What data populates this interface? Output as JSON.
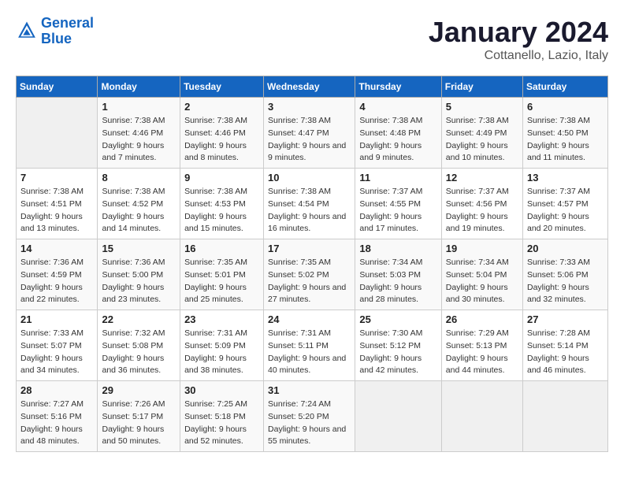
{
  "logo": {
    "line1": "General",
    "line2": "Blue"
  },
  "title": "January 2024",
  "subtitle": "Cottanello, Lazio, Italy",
  "days_of_week": [
    "Sunday",
    "Monday",
    "Tuesday",
    "Wednesday",
    "Thursday",
    "Friday",
    "Saturday"
  ],
  "weeks": [
    [
      {
        "day": "",
        "sunrise": "",
        "sunset": "",
        "daylight": ""
      },
      {
        "day": "1",
        "sunrise": "Sunrise: 7:38 AM",
        "sunset": "Sunset: 4:46 PM",
        "daylight": "Daylight: 9 hours and 7 minutes."
      },
      {
        "day": "2",
        "sunrise": "Sunrise: 7:38 AM",
        "sunset": "Sunset: 4:46 PM",
        "daylight": "Daylight: 9 hours and 8 minutes."
      },
      {
        "day": "3",
        "sunrise": "Sunrise: 7:38 AM",
        "sunset": "Sunset: 4:47 PM",
        "daylight": "Daylight: 9 hours and 9 minutes."
      },
      {
        "day": "4",
        "sunrise": "Sunrise: 7:38 AM",
        "sunset": "Sunset: 4:48 PM",
        "daylight": "Daylight: 9 hours and 9 minutes."
      },
      {
        "day": "5",
        "sunrise": "Sunrise: 7:38 AM",
        "sunset": "Sunset: 4:49 PM",
        "daylight": "Daylight: 9 hours and 10 minutes."
      },
      {
        "day": "6",
        "sunrise": "Sunrise: 7:38 AM",
        "sunset": "Sunset: 4:50 PM",
        "daylight": "Daylight: 9 hours and 11 minutes."
      }
    ],
    [
      {
        "day": "7",
        "sunrise": "Sunrise: 7:38 AM",
        "sunset": "Sunset: 4:51 PM",
        "daylight": "Daylight: 9 hours and 13 minutes."
      },
      {
        "day": "8",
        "sunrise": "Sunrise: 7:38 AM",
        "sunset": "Sunset: 4:52 PM",
        "daylight": "Daylight: 9 hours and 14 minutes."
      },
      {
        "day": "9",
        "sunrise": "Sunrise: 7:38 AM",
        "sunset": "Sunset: 4:53 PM",
        "daylight": "Daylight: 9 hours and 15 minutes."
      },
      {
        "day": "10",
        "sunrise": "Sunrise: 7:38 AM",
        "sunset": "Sunset: 4:54 PM",
        "daylight": "Daylight: 9 hours and 16 minutes."
      },
      {
        "day": "11",
        "sunrise": "Sunrise: 7:37 AM",
        "sunset": "Sunset: 4:55 PM",
        "daylight": "Daylight: 9 hours and 17 minutes."
      },
      {
        "day": "12",
        "sunrise": "Sunrise: 7:37 AM",
        "sunset": "Sunset: 4:56 PM",
        "daylight": "Daylight: 9 hours and 19 minutes."
      },
      {
        "day": "13",
        "sunrise": "Sunrise: 7:37 AM",
        "sunset": "Sunset: 4:57 PM",
        "daylight": "Daylight: 9 hours and 20 minutes."
      }
    ],
    [
      {
        "day": "14",
        "sunrise": "Sunrise: 7:36 AM",
        "sunset": "Sunset: 4:59 PM",
        "daylight": "Daylight: 9 hours and 22 minutes."
      },
      {
        "day": "15",
        "sunrise": "Sunrise: 7:36 AM",
        "sunset": "Sunset: 5:00 PM",
        "daylight": "Daylight: 9 hours and 23 minutes."
      },
      {
        "day": "16",
        "sunrise": "Sunrise: 7:35 AM",
        "sunset": "Sunset: 5:01 PM",
        "daylight": "Daylight: 9 hours and 25 minutes."
      },
      {
        "day": "17",
        "sunrise": "Sunrise: 7:35 AM",
        "sunset": "Sunset: 5:02 PM",
        "daylight": "Daylight: 9 hours and 27 minutes."
      },
      {
        "day": "18",
        "sunrise": "Sunrise: 7:34 AM",
        "sunset": "Sunset: 5:03 PM",
        "daylight": "Daylight: 9 hours and 28 minutes."
      },
      {
        "day": "19",
        "sunrise": "Sunrise: 7:34 AM",
        "sunset": "Sunset: 5:04 PM",
        "daylight": "Daylight: 9 hours and 30 minutes."
      },
      {
        "day": "20",
        "sunrise": "Sunrise: 7:33 AM",
        "sunset": "Sunset: 5:06 PM",
        "daylight": "Daylight: 9 hours and 32 minutes."
      }
    ],
    [
      {
        "day": "21",
        "sunrise": "Sunrise: 7:33 AM",
        "sunset": "Sunset: 5:07 PM",
        "daylight": "Daylight: 9 hours and 34 minutes."
      },
      {
        "day": "22",
        "sunrise": "Sunrise: 7:32 AM",
        "sunset": "Sunset: 5:08 PM",
        "daylight": "Daylight: 9 hours and 36 minutes."
      },
      {
        "day": "23",
        "sunrise": "Sunrise: 7:31 AM",
        "sunset": "Sunset: 5:09 PM",
        "daylight": "Daylight: 9 hours and 38 minutes."
      },
      {
        "day": "24",
        "sunrise": "Sunrise: 7:31 AM",
        "sunset": "Sunset: 5:11 PM",
        "daylight": "Daylight: 9 hours and 40 minutes."
      },
      {
        "day": "25",
        "sunrise": "Sunrise: 7:30 AM",
        "sunset": "Sunset: 5:12 PM",
        "daylight": "Daylight: 9 hours and 42 minutes."
      },
      {
        "day": "26",
        "sunrise": "Sunrise: 7:29 AM",
        "sunset": "Sunset: 5:13 PM",
        "daylight": "Daylight: 9 hours and 44 minutes."
      },
      {
        "day": "27",
        "sunrise": "Sunrise: 7:28 AM",
        "sunset": "Sunset: 5:14 PM",
        "daylight": "Daylight: 9 hours and 46 minutes."
      }
    ],
    [
      {
        "day": "28",
        "sunrise": "Sunrise: 7:27 AM",
        "sunset": "Sunset: 5:16 PM",
        "daylight": "Daylight: 9 hours and 48 minutes."
      },
      {
        "day": "29",
        "sunrise": "Sunrise: 7:26 AM",
        "sunset": "Sunset: 5:17 PM",
        "daylight": "Daylight: 9 hours and 50 minutes."
      },
      {
        "day": "30",
        "sunrise": "Sunrise: 7:25 AM",
        "sunset": "Sunset: 5:18 PM",
        "daylight": "Daylight: 9 hours and 52 minutes."
      },
      {
        "day": "31",
        "sunrise": "Sunrise: 7:24 AM",
        "sunset": "Sunset: 5:20 PM",
        "daylight": "Daylight: 9 hours and 55 minutes."
      },
      {
        "day": "",
        "sunrise": "",
        "sunset": "",
        "daylight": ""
      },
      {
        "day": "",
        "sunrise": "",
        "sunset": "",
        "daylight": ""
      },
      {
        "day": "",
        "sunrise": "",
        "sunset": "",
        "daylight": ""
      }
    ]
  ]
}
